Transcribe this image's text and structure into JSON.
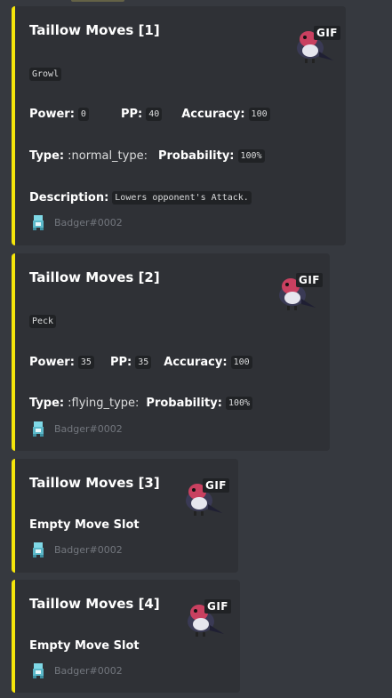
{
  "colors": {
    "accent": "#f5e50b",
    "embed_bg": "#2f3136",
    "page_bg": "#36393f"
  },
  "embeds": [
    {
      "title": "Taillow Moves [1]",
      "move": "Growl",
      "power_label": "Power:",
      "power": "0",
      "pp_label": "PP:",
      "pp": "40",
      "accuracy_label": "Accuracy:",
      "accuracy": "100",
      "type_label": "Type:",
      "type": ":normal_type:",
      "prob_label": "Probability:",
      "probability": "100%",
      "desc_label": "Description:",
      "description": "Lowers opponent's Attack.",
      "footer": "Badger#0002",
      "gif_label": "GIF",
      "thumbnail_icon": "taillow-sprite-icon",
      "footer_icon": "badger-avatar-icon"
    },
    {
      "title": "Taillow Moves [2]",
      "move": "Peck",
      "power_label": "Power:",
      "power": "35",
      "pp_label": "PP:",
      "pp": "35",
      "accuracy_label": "Accuracy:",
      "accuracy": "100",
      "type_label": "Type:",
      "type": ":flying_type:",
      "prob_label": "Probability:",
      "probability": "100%",
      "footer": "Badger#0002",
      "gif_label": "GIF"
    },
    {
      "title": "Taillow Moves [3]",
      "empty": "Empty Move Slot",
      "footer": "Badger#0002",
      "gif_label": "GIF"
    },
    {
      "title": "Taillow Moves [4]",
      "empty": "Empty Move Slot",
      "footer": "Badger#0002",
      "gif_label": "GIF"
    }
  ]
}
